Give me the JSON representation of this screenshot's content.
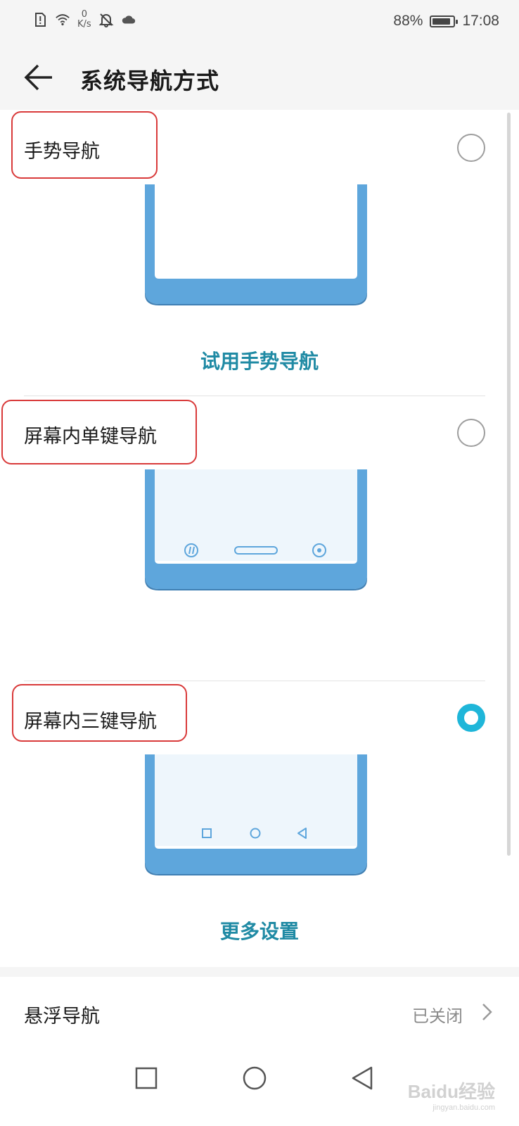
{
  "status_bar": {
    "net_speed_value": "0",
    "net_speed_unit": "K/s",
    "battery_percent": "88%",
    "battery_level": 0.88,
    "time": "17:08",
    "icons": [
      "sim-alert-icon",
      "wifi-icon",
      "net-speed",
      "bell-off-icon",
      "cloud-icon",
      "battery-icon"
    ]
  },
  "header": {
    "title": "系统导航方式"
  },
  "options": [
    {
      "label": "手势导航",
      "selected": false,
      "link_label": "试用手势导航",
      "preview_icons": []
    },
    {
      "label": "屏幕内单键导航",
      "selected": false,
      "preview_icons": [
        "pause-dot-icon",
        "pill-nav-icon",
        "target-icon"
      ]
    },
    {
      "label": "屏幕内三键导航",
      "selected": true,
      "link_label": "更多设置",
      "preview_icons": [
        "square-icon",
        "circle-icon",
        "triangle-back-icon"
      ]
    }
  ],
  "float_nav": {
    "label": "悬浮导航",
    "value": "已关闭"
  },
  "system_nav": [
    "recent-apps-icon",
    "home-icon",
    "back-icon"
  ],
  "watermark": {
    "text": "Baidu经验",
    "sub": "jingyan.baidu.com"
  },
  "colors": {
    "accent": "#1fb6d9",
    "link": "#1f8aa4",
    "phone_frame": "#5ea6dc",
    "highlight_box": "#d93a3a"
  }
}
